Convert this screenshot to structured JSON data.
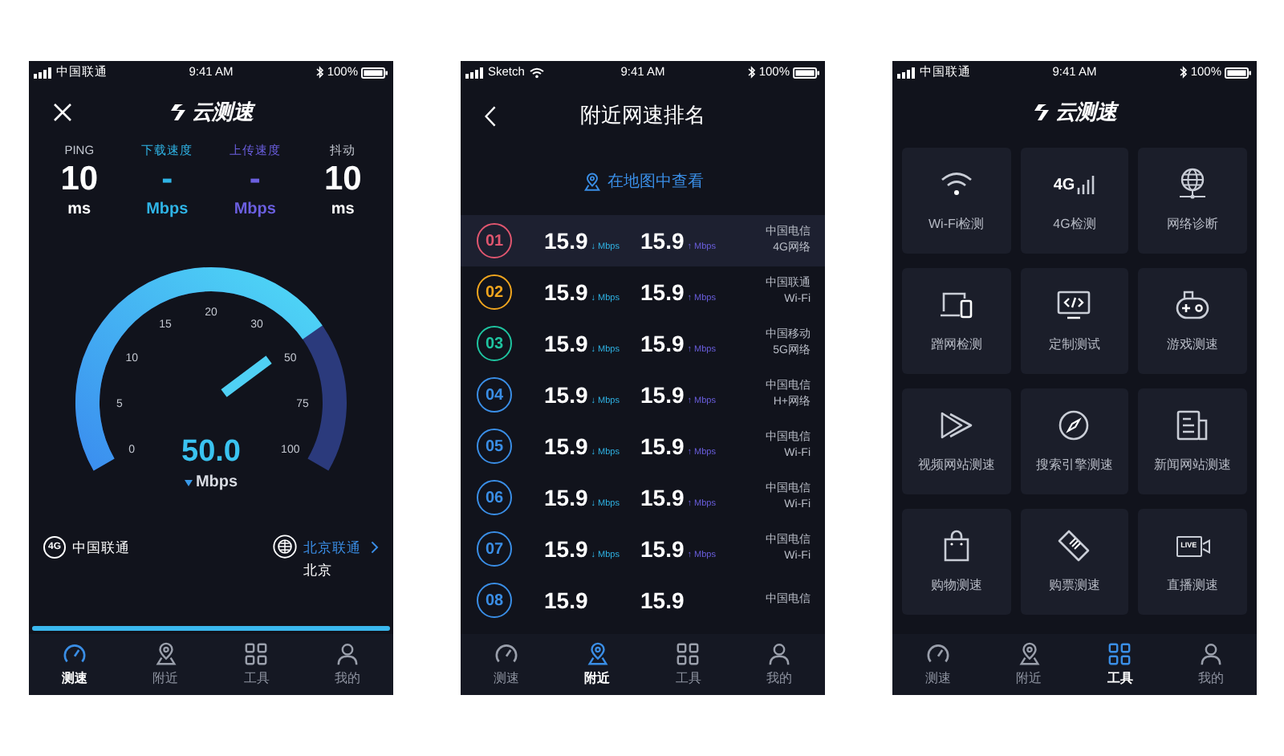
{
  "screens": [
    {
      "kind": "speed_test",
      "status_bar": {
        "carrier": "中国联通",
        "time": "9:41 AM",
        "battery": "100%"
      },
      "logo": "云测速",
      "stats": [
        {
          "kind": "ping",
          "label": "PING",
          "value": "10",
          "unit": "ms"
        },
        {
          "kind": "download",
          "label": "下载速度",
          "value": "-",
          "unit": "Mbps"
        },
        {
          "kind": "upload",
          "label": "上传速度",
          "value": "-",
          "unit": "Mbps"
        },
        {
          "kind": "jitter",
          "label": "抖动",
          "value": "10",
          "unit": "ms"
        }
      ],
      "gauge": {
        "ticks": [
          "0",
          "5",
          "10",
          "15",
          "20",
          "30",
          "50",
          "75",
          "100"
        ],
        "level": 0.73,
        "reading": "50.0",
        "unit": "Mbps"
      },
      "network": {
        "type": "4G",
        "carrier": "中国联通"
      },
      "server": {
        "name": "北京联通",
        "city": "北京"
      },
      "progress": {
        "level": 1
      },
      "tabs": [
        {
          "kind": "gauge",
          "label": "测速",
          "selected": true
        },
        {
          "kind": "pin",
          "label": "附近",
          "selected": false
        },
        {
          "kind": "grid",
          "label": "工具",
          "selected": false
        },
        {
          "kind": "person",
          "label": "我的",
          "selected": false
        }
      ]
    },
    {
      "kind": "nearby_ranking",
      "status_bar": {
        "carrier": "Sketch",
        "wifi": true,
        "time": "9:41 AM",
        "battery": "100%"
      },
      "title": "附近网速排名",
      "map_link": "在地图中查看",
      "rows": [
        {
          "rank": "01",
          "color": "#e0566f",
          "selected": true,
          "download": "15.9",
          "download_unit": "↓ Mbps",
          "upload": "15.9",
          "upload_unit": "↑ Mbps",
          "carrier": "中国电信",
          "network": "4G网络"
        },
        {
          "rank": "02",
          "color": "#f0a51e",
          "selected": false,
          "download": "15.9",
          "download_unit": "↓ Mbps",
          "upload": "15.9",
          "upload_unit": "↑ Mbps",
          "carrier": "中国联通",
          "network": "Wi-Fi"
        },
        {
          "rank": "03",
          "color": "#1fc4a0",
          "selected": false,
          "download": "15.9",
          "download_unit": "↓ Mbps",
          "upload": "15.9",
          "upload_unit": "↑ Mbps",
          "carrier": "中国移动",
          "network": "5G网络"
        },
        {
          "rank": "04",
          "color": "#3a8ee6",
          "selected": false,
          "download": "15.9",
          "download_unit": "↓ Mbps",
          "upload": "15.9",
          "upload_unit": "↑ Mbps",
          "carrier": "中国电信",
          "network": "H+网络"
        },
        {
          "rank": "05",
          "color": "#3a8ee6",
          "selected": false,
          "download": "15.9",
          "download_unit": "↓ Mbps",
          "upload": "15.9",
          "upload_unit": "↑ Mbps",
          "carrier": "中国电信",
          "network": "Wi-Fi"
        },
        {
          "rank": "06",
          "color": "#3a8ee6",
          "selected": false,
          "download": "15.9",
          "download_unit": "↓ Mbps",
          "upload": "15.9",
          "upload_unit": "↑ Mbps",
          "carrier": "中国电信",
          "network": "Wi-Fi"
        },
        {
          "rank": "07",
          "color": "#3a8ee6",
          "selected": false,
          "download": "15.9",
          "download_unit": "↓ Mbps",
          "upload": "15.9",
          "upload_unit": "↑ Mbps",
          "carrier": "中国电信",
          "network": "Wi-Fi"
        },
        {
          "rank": "08",
          "color": "#3a8ee6",
          "selected": false,
          "download": "15.9",
          "upload": "15.9",
          "carrier": "中国电信"
        }
      ],
      "tabs": [
        {
          "kind": "gauge",
          "label": "测速",
          "selected": false
        },
        {
          "kind": "pin",
          "label": "附近",
          "selected": true
        },
        {
          "kind": "grid",
          "label": "工具",
          "selected": false
        },
        {
          "kind": "person",
          "label": "我的",
          "selected": false
        }
      ]
    },
    {
      "kind": "tools",
      "status_bar": {
        "carrier": "中国联通",
        "time": "9:41 AM",
        "battery": "100%"
      },
      "logo": "云测速",
      "tiles": [
        {
          "kind": "wifi",
          "label": "Wi-Fi检测"
        },
        {
          "kind": "signal",
          "label": "4G检测",
          "icon_text": "4G"
        },
        {
          "kind": "globe",
          "label": "网络诊断"
        },
        {
          "kind": "devices",
          "label": "蹭网检测"
        },
        {
          "kind": "code",
          "label": "定制测试"
        },
        {
          "kind": "gamepad",
          "label": "游戏测速"
        },
        {
          "kind": "play",
          "label": "视频网站测速"
        },
        {
          "kind": "compass",
          "label": "搜索引擎测速"
        },
        {
          "kind": "news",
          "label": "新闻网站测速"
        },
        {
          "kind": "bag",
          "label": "购物测速"
        },
        {
          "kind": "ticket",
          "label": "购票测速"
        },
        {
          "kind": "live",
          "label": "直播测速",
          "icon_text": "LIVE"
        }
      ],
      "tabs": [
        {
          "kind": "gauge",
          "label": "测速",
          "selected": false
        },
        {
          "kind": "pin",
          "label": "附近",
          "selected": false
        },
        {
          "kind": "grid",
          "label": "工具",
          "selected": true
        },
        {
          "kind": "person",
          "label": "我的",
          "selected": false
        }
      ]
    }
  ]
}
